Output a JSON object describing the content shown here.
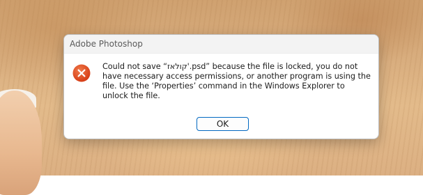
{
  "dialog": {
    "title": "Adobe Photoshop",
    "icon": "error-icon",
    "message": "Could not save “קולאז'.psd” because the file is locked, you do not have necessary access permissions, or another program is using the file. Use the ‘Properties’ command in the Windows Explorer to unlock the file.",
    "ok_label": "OK"
  },
  "colors": {
    "error_red": "#e0481f",
    "button_border": "#0067c0"
  }
}
